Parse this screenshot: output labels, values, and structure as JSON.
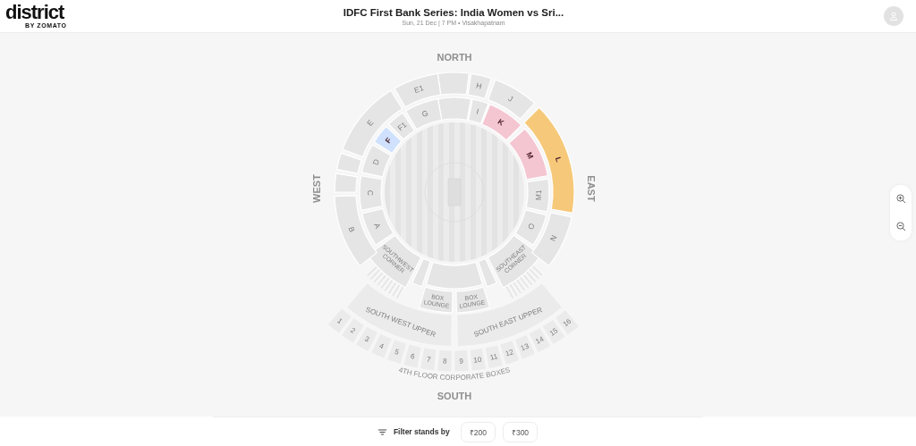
{
  "header": {
    "logo": "district",
    "logo_sub": "BY ZOMATO",
    "title": "IDFC First Bank Series: India Women vs Sri...",
    "subtitle": "Sun, 21 Dec | 7 PM • Visakhapatnam"
  },
  "compass": {
    "north": "NORTH",
    "east": "EAST",
    "south": "SOUTH",
    "west": "WEST"
  },
  "stands": [
    {
      "available": false
    },
    {
      "label": "I",
      "available": false
    },
    {
      "label": "K",
      "available": true,
      "color": "#f4c6d1"
    },
    {
      "label": "M",
      "available": true,
      "color": "#f4c6d1"
    },
    {
      "label": "M1",
      "available": false
    },
    {
      "label": "O",
      "available": false
    },
    {
      "label": "SOUTHEAST CORNER",
      "available": false
    },
    {
      "available": false
    },
    {
      "available": false
    },
    {
      "available": false
    },
    {
      "label": "SOUTHWEST CORNER",
      "available": false
    },
    {
      "label": "A",
      "available": false
    },
    {
      "label": "C",
      "available": false
    },
    {
      "label": "D",
      "available": false
    },
    {
      "label": "F",
      "available": true,
      "color": "#cfe1fc"
    },
    {
      "label": "F1",
      "available": false
    },
    {
      "label": "G",
      "available": false
    },
    {
      "available": false
    },
    {
      "label": "H",
      "available": false
    },
    {
      "label": "J",
      "available": false
    },
    {
      "label": "L",
      "available": true,
      "color": "#f6c97a"
    },
    {
      "label": "N",
      "available": false
    },
    {
      "label": "BOX LOUNGE",
      "available": false
    },
    {
      "label": "BOX LOUNGE",
      "available": false
    },
    {
      "label": "B",
      "available": false
    },
    {
      "available": false
    },
    {
      "available": false
    },
    {
      "label": "E",
      "available": false
    },
    {
      "label": "E1",
      "available": false
    }
  ],
  "upper_stands": [
    {
      "label": "SOUTH WEST UPPER"
    },
    {
      "label": "SOUTH EAST UPPER"
    }
  ],
  "corporate_boxes": {
    "label": "4TH FLOOR CORPORATE BOXES",
    "boxes": [
      "1",
      "2",
      "3",
      "4",
      "5",
      "6",
      "7",
      "8",
      "9",
      "10",
      "11",
      "12",
      "13",
      "14",
      "15",
      "16"
    ]
  },
  "filter": {
    "label": "Filter stands by",
    "options": [
      {
        "label": "₹200"
      },
      {
        "label": "₹300"
      }
    ]
  }
}
